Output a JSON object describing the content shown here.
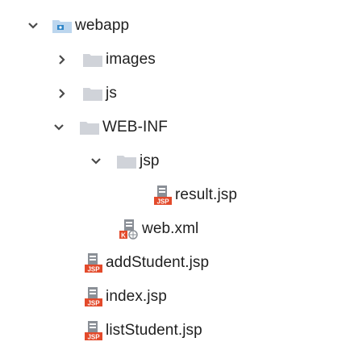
{
  "tree": {
    "webapp": "webapp",
    "images": "images",
    "js": "js",
    "webinf": "WEB-INF",
    "jsp": "jsp",
    "result_jsp": "result.jsp",
    "web_xml": "web.xml",
    "add_student": "addStudent.jsp",
    "index_jsp": "index.jsp",
    "list_student": "listStudent.jsp"
  },
  "icons": {
    "jsp_badge": "JSP",
    "xml_badge": "K"
  },
  "colors": {
    "chevron": "#4a4a4a",
    "folder": "#d0d3d9",
    "webapp_folder": "#bcd6ee",
    "webapp_badge": "#2f86c8",
    "jsp_red": "#e34a2b",
    "page_gray": "#8a8f96"
  }
}
